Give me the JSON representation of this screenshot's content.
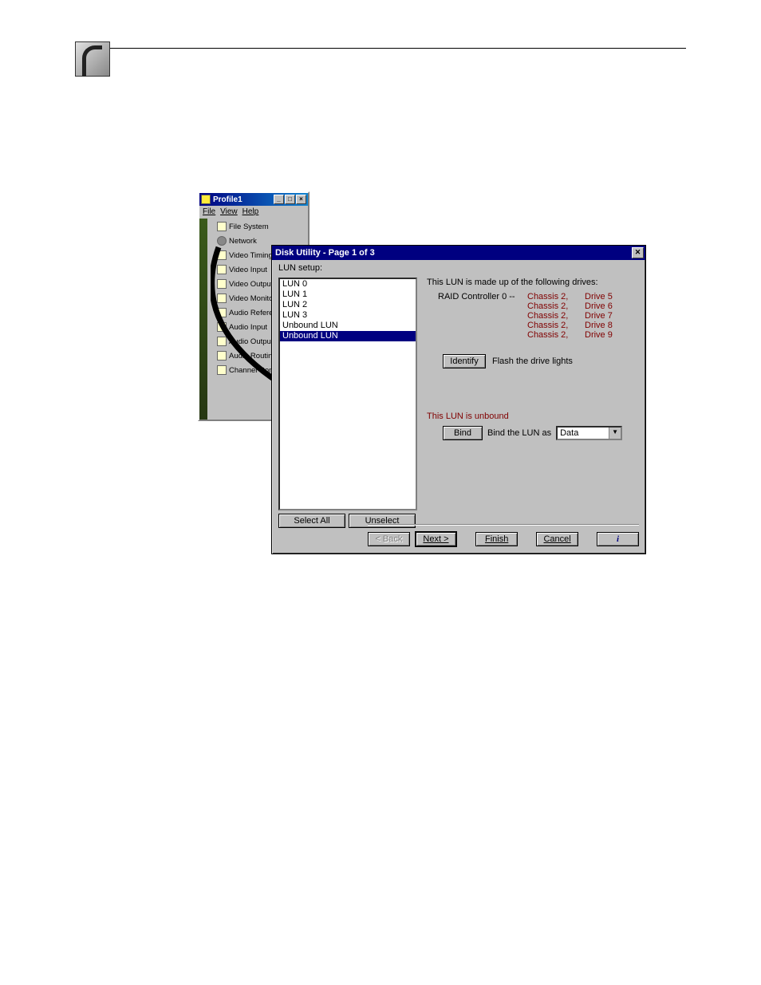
{
  "profile_window": {
    "title": "Profile1",
    "menu": {
      "file": "File",
      "view": "View",
      "help": "Help"
    },
    "tree": [
      {
        "label": "File System"
      },
      {
        "label": "Network"
      },
      {
        "label": "Video Timing"
      },
      {
        "label": "Video Input"
      },
      {
        "label": "Video Output"
      },
      {
        "label": "Video Monitor"
      },
      {
        "label": "Audio Reference"
      },
      {
        "label": "Audio Input"
      },
      {
        "label": "Audio Output"
      },
      {
        "label": "Audio Routing"
      },
      {
        "label": "Channel Config"
      }
    ]
  },
  "dialog": {
    "title": "Disk Utility - Page 1 of 3",
    "lun_setup_label": "LUN setup:",
    "list": [
      "LUN 0",
      "LUN 1",
      "LUN 2",
      "LUN 3",
      "Unbound LUN",
      "Unbound LUN"
    ],
    "selected_index": 5,
    "select_all": "Select All",
    "unselect": "Unselect",
    "made_up": "This LUN is made up of the following drives:",
    "raid_controller_label": "RAID Controller 0 --",
    "drives": [
      {
        "chassis": "Chassis 2,",
        "drive": "Drive 5"
      },
      {
        "chassis": "Chassis 2,",
        "drive": "Drive 6"
      },
      {
        "chassis": "Chassis 2,",
        "drive": "Drive 7"
      },
      {
        "chassis": "Chassis 2,",
        "drive": "Drive 8"
      },
      {
        "chassis": "Chassis 2,",
        "drive": "Drive 9"
      }
    ],
    "identify": "Identify",
    "identify_hint": "Flash the drive lights",
    "status": "This LUN is unbound",
    "bind": "Bind",
    "bind_as_label": "Bind the LUN as",
    "bind_as_value": "Data",
    "nav": {
      "back": "< Back",
      "next": "Next >",
      "finish": "Finish",
      "cancel": "Cancel",
      "info": "i"
    }
  }
}
